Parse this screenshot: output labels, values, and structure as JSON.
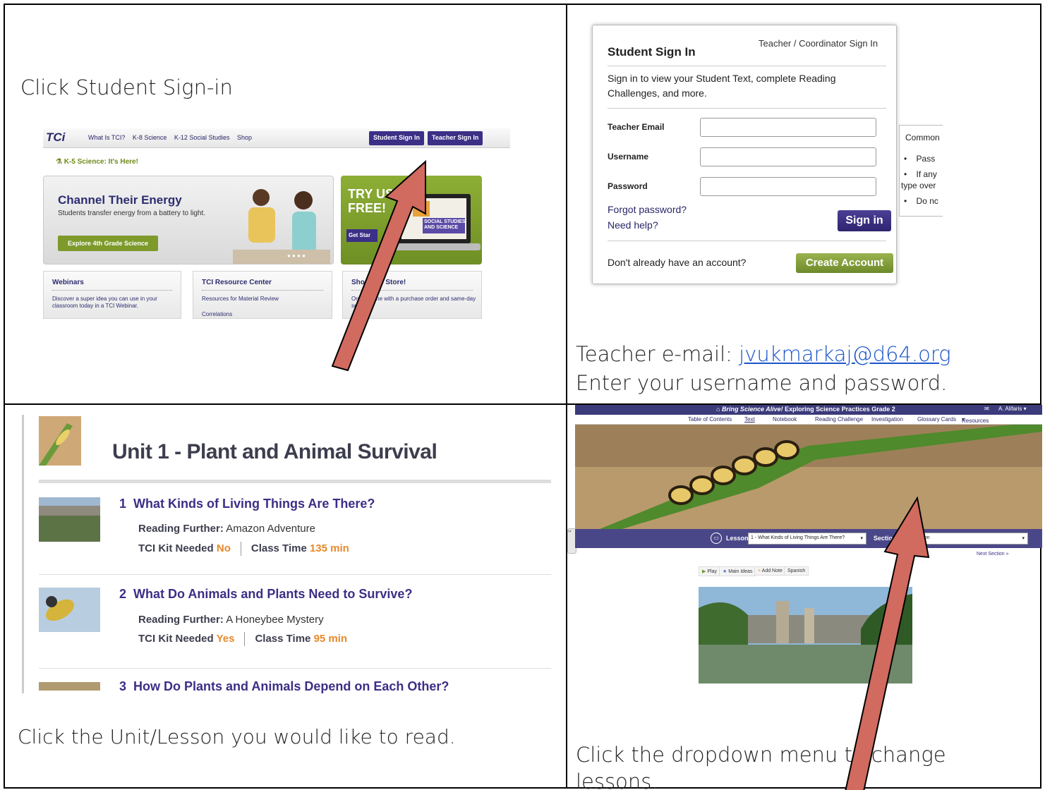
{
  "q1": {
    "caption": "Click Student Sign-in",
    "nav": {
      "logo": "TCi",
      "links": [
        "What Is TCI?",
        "K-8 Science",
        "K-12 Social Studies",
        "Shop"
      ],
      "student_btn": "Student Sign In",
      "teacher_btn": "Teacher Sign In"
    },
    "k5": "K-5 Science: It's Here!",
    "hero": {
      "title": "Channel Their Energy",
      "sub": "Students transfer energy from a battery to light.",
      "btn": "Explore 4th Grade Science"
    },
    "try": {
      "line1": "TRY US",
      "line2": "FREE!",
      "btn": "Get Star",
      "laptop_text": "SOCIAL STUDIES AND SCIENCE"
    },
    "boxes": [
      {
        "title": "Webinars",
        "text": "Discover a super idea you can use in your classroom today in a TCI Webinar."
      },
      {
        "title": "TCI Resource Center",
        "text": "Resources for Material Review",
        "text2": "Correlations"
      },
      {
        "title": "Shop Our Store!",
        "text": "Order online with a purchase order and same-day service!"
      }
    ]
  },
  "q2": {
    "title": "Student Sign In",
    "teacher_link": "Teacher / Coordinator Sign In",
    "desc": "Sign in to view your Student Text, complete Reading Challenges, and more.",
    "fields": [
      "Teacher Email",
      "Username",
      "Password"
    ],
    "forgot": "Forgot password?",
    "help": "Need help?",
    "signin_btn": "Sign in",
    "dont": "Don't already have an account?",
    "create_btn": "Create Account",
    "tooltip": [
      "Common",
      "Pass",
      "If any",
      "type over",
      "Do nc"
    ],
    "email_label": "Teacher e-mail:",
    "email": "jvukmarkaj@d64.org",
    "instruction": "Enter your username and password."
  },
  "q3": {
    "unit_title": "Unit 1 - Plant and Animal Survival",
    "lessons": [
      {
        "num": "1",
        "title": "What Kinds of Living Things Are There?",
        "rf_label": "Reading Further:",
        "rf": "Amazon Adventure",
        "kit_label": "TCI Kit Needed",
        "kit": "No",
        "time_label": "Class Time",
        "time": "135 min"
      },
      {
        "num": "2",
        "title": "What Do Animals and Plants Need to Survive?",
        "rf_label": "Reading Further:",
        "rf": "A Honeybee Mystery",
        "kit_label": "TCI Kit Needed",
        "kit": "Yes",
        "time_label": "Class Time",
        "time": "95 min"
      },
      {
        "num": "3",
        "title": "How Do Plants and Animals Depend on Each Other?"
      }
    ],
    "caption": "Click the Unit/Lesson you would like to read."
  },
  "q4": {
    "header_brand": "Bring Science Alive!",
    "header_title": "Exploring Science Practices Grade 2",
    "user": "A. Alifaris",
    "tabs": [
      "Table of Contents",
      "Text",
      "Notebook",
      "Reading Challenge",
      "Investigation",
      "Glossary Cards",
      "Resources"
    ],
    "lesson_label": "Lesson:",
    "lesson_value": "1 - What Kinds of Living Things Are There?",
    "section_label": "Section:",
    "section_value": "Introduction",
    "next": "Next Section »",
    "tools": [
      "Play",
      "Main Ideas",
      "Add Note",
      "Spanish"
    ],
    "caption": "Click the dropdown menu to change lessons."
  },
  "colors": {
    "tci_purple": "#3b2f86",
    "tci_green": "#7d9a2b",
    "orange": "#e7892a",
    "arrow": "#d16a5f"
  }
}
